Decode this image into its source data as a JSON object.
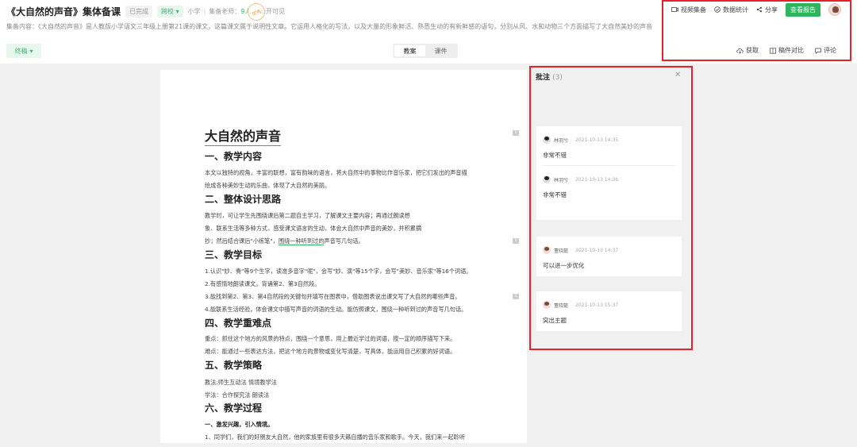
{
  "header": {
    "title": "《大自然的声音》集体备课",
    "status_tag": "已完成",
    "scope_tag": "跨校",
    "level": "小学",
    "teachers_label": "集备老师：",
    "teachers_count": "9人",
    "visibility": "公开可见",
    "stamp_text": "优秀",
    "description": "集备内容：《大自然的声音》是人教版小学语文三年级上册第21课的课文，这篇课文属于说明性文章。它运用人格化的写法，以及大量的形象鲜活、熟悉生动的有新鲜感的语句，分别从风、水和动物三个方面描写了大自然美妙的声音",
    "final_button": "终稿",
    "tabs": [
      "教案",
      "课件"
    ],
    "active_tab": "教案",
    "toolbar_top": [
      "视频集备",
      "数据统计",
      "分享"
    ],
    "report_button": "查看报告",
    "toolbar_bottom": [
      "获取",
      "稿件对比",
      "评论"
    ]
  },
  "doc": {
    "title": "大自然的声音",
    "sections": [
      "一、教学内容",
      "二、整体设计思路",
      "三、教学目标",
      "四、教学重难点",
      "五、教学策略",
      "六、教学过程"
    ],
    "p1a": "本文以独特的视角，丰富的联想，富有韵味的语言，将大自然中的事物比作音乐家，把它们发出的声音描",
    "p1b": "绘成各种美妙生动的乐曲，体现了大自然的美丽。",
    "p2a": "教学时，可让学生先围绕课后第二题自主学习，了解课文主要内容；再通过朗读想",
    "p2b": "象、联系生活等多种方式，感受课文语言的生动，体会大自然中声音的美妙，并积累摘",
    "p2c_pre": "抄；然后结合课后\"小练笔\"，",
    "p2c_hl": "围绕一种听到过的",
    "p2c_post": "声音写几句话。",
    "g1": "1.认识\"妙、奏\"等9个生字，读准多音字\"呢\"，会写\"妙、演\"等15个字，会写\"美妙、音乐家\"等16个词语。",
    "g2": "2.有感情地朗读课文。背诵第2、第3自然段。",
    "g3": "3.能找到第2、第3、第4自然段的关键句并填写在图表中，借助图表说出课文写了大自然的哪些声音。",
    "g4": "4.能联系生活经验，体会课文中描写声音的词语的生动。能仿照课文，围绕一种听到过的声音写几句话。",
    "k1": "重点：抓住这个地方的风景的特点，围绕一个意思，用上最近学过的词语，按一定的顺序描写下来。",
    "k2": "难点：能通过一些表达方法，把这个地方的景物或变化写清楚，写具体，能运用自己积累的好词语。",
    "s1": "教法:师生互动法 情境教学法",
    "s2": "学法：合作探究法 朗读法",
    "proc1": "一、激发兴趣，引入情境。",
    "proc2": "1、同学们，我们的好朋友大自然，他的家族里有很多天籁自播的音乐家和歌手。今天，我们来一起聆听",
    "markers": [
      "1",
      "1",
      "1"
    ]
  },
  "panel": {
    "title": "批注",
    "count": "(3)",
    "comments": [
      {
        "name": "林羽兮",
        "time": "2021-10-13 14:35",
        "text": "非常不错"
      },
      {
        "name": "林羽兮",
        "time": "2021-10-13 14:36",
        "text": "非常不错"
      },
      {
        "name": "董晓懿",
        "time": "2021-10-13 14:37",
        "text": "可以进一步优化"
      },
      {
        "name": "董晓懿",
        "time": "2021-10-13 15:37",
        "text": "突出主题"
      }
    ]
  },
  "colors": {
    "accent": "#2db55d",
    "highlight_box": "#e8202a"
  }
}
